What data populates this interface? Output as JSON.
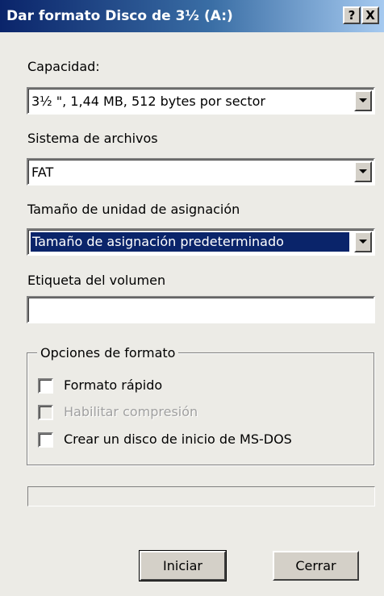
{
  "window": {
    "title": "Dar formato Disco de 3½ (A:)",
    "help_glyph": "?",
    "close_glyph": "X"
  },
  "capacity": {
    "label": "Capacidad:",
    "value": "3½ \", 1,44 MB, 512 bytes por sector"
  },
  "filesystem": {
    "label": "Sistema de archivos",
    "value": "FAT"
  },
  "allocation": {
    "label": "Tamaño de unidad de asignación",
    "value": "Tamaño de asignación predeterminado"
  },
  "volume": {
    "label": "Etiqueta del volumen",
    "value": ""
  },
  "options": {
    "legend": "Opciones de formato",
    "quick_format": {
      "label": "Formato rápido",
      "checked": false,
      "enabled": true
    },
    "enable_compression": {
      "label": "Habilitar compresión",
      "checked": false,
      "enabled": false
    },
    "msdos_startup": {
      "label": "Crear un disco de inicio de MS-DOS",
      "checked": false,
      "enabled": true
    }
  },
  "progress": {
    "value": 0
  },
  "buttons": {
    "start": "Iniciar",
    "close": "Cerrar"
  },
  "colors": {
    "title_start": "#0a246a",
    "title_end": "#a6caf0",
    "selection": "#0a246a",
    "face": "#ecebe6"
  }
}
